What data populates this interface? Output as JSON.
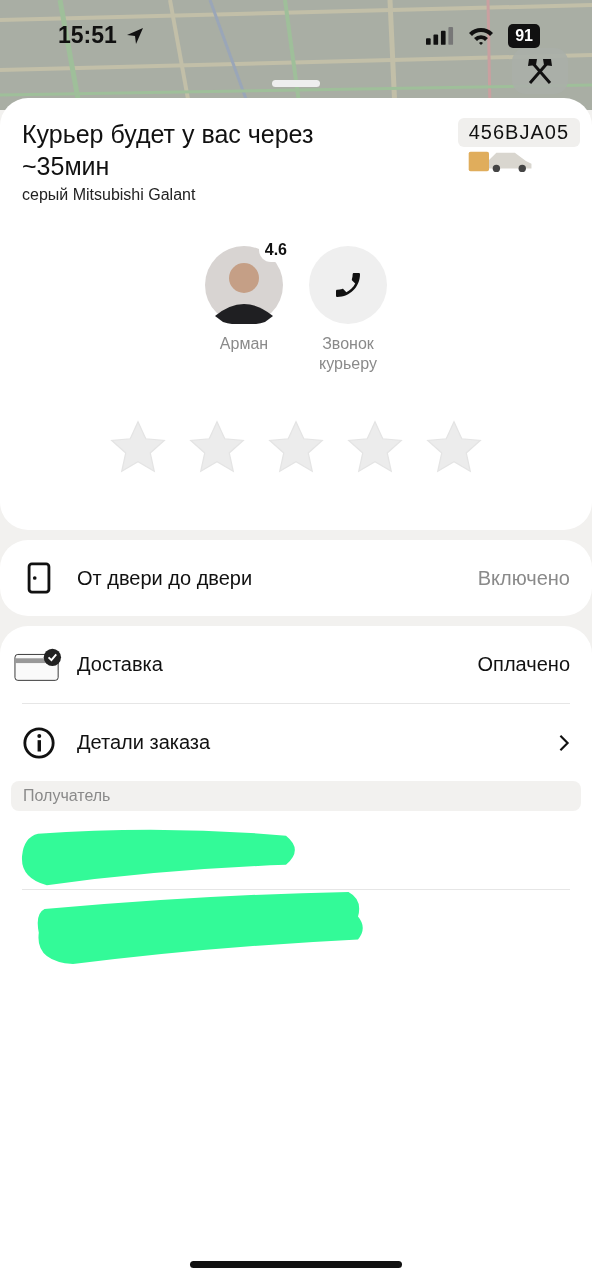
{
  "status_bar": {
    "time": "15:51",
    "battery": "91"
  },
  "header": {
    "title": "Курьер будет у вас через ~35мин",
    "car": "серый Mitsubishi Galant",
    "plate": "456BJA05"
  },
  "contacts": [
    {
      "kind": "courier",
      "label": "Арман",
      "rating": "4.6"
    },
    {
      "kind": "call",
      "label": "Звонок курьеру"
    }
  ],
  "rating": {
    "stars": 0
  },
  "options": [
    {
      "kind": "door",
      "label": "От двери до двери",
      "value": "Включено"
    }
  ],
  "order": {
    "rows": [
      {
        "kind": "payment",
        "label": "Доставка",
        "value": "Оплачено"
      },
      {
        "kind": "details",
        "label": "Детали заказа"
      }
    ],
    "section": "Получатель"
  }
}
